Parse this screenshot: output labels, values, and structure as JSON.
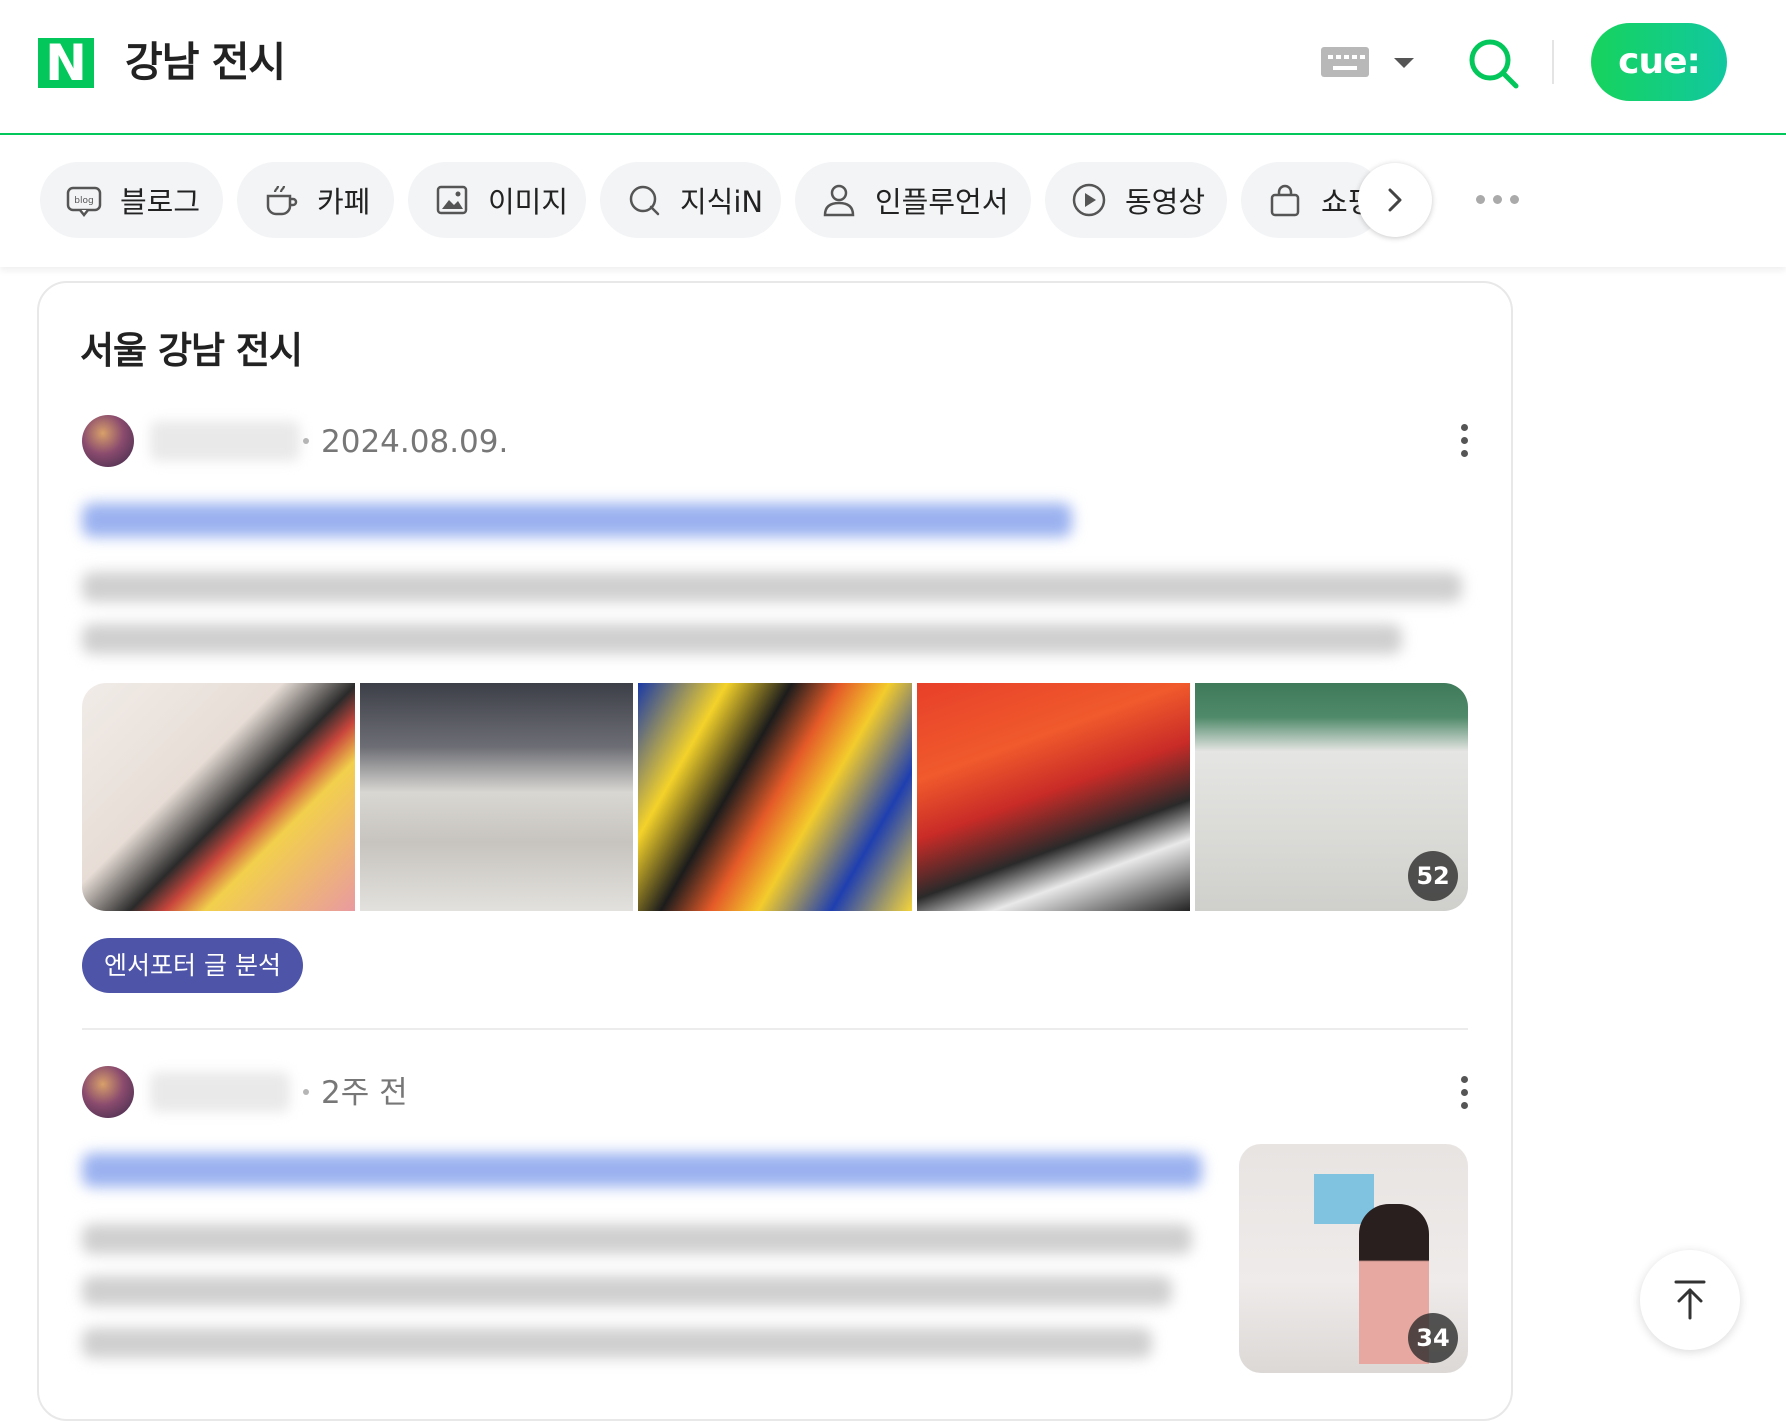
{
  "header": {
    "logo": "N",
    "query": "강남 전시",
    "cue_label": "cue:"
  },
  "tabs": [
    {
      "label": "블로그",
      "icon": "blog-icon"
    },
    {
      "label": "카페",
      "icon": "cup-icon"
    },
    {
      "label": "이미지",
      "icon": "image-icon"
    },
    {
      "label": "지식iN",
      "icon": "q-icon"
    },
    {
      "label": "인플루언서",
      "icon": "person-icon"
    },
    {
      "label": "동영상",
      "icon": "play-icon"
    },
    {
      "label": "쇼핑",
      "icon": "bag-icon"
    }
  ],
  "blog_icon_text": "blog",
  "section": {
    "title": "서울 강남 전시"
  },
  "posts": [
    {
      "date": "2024.08.09.",
      "photo_count": "52",
      "insight_label": "엔서포터 글 분석"
    },
    {
      "date": "2주 전",
      "photo_count": "34"
    }
  ],
  "colors": {
    "brand_green": "#03c75a",
    "insight_purple": "#4e55a8"
  }
}
